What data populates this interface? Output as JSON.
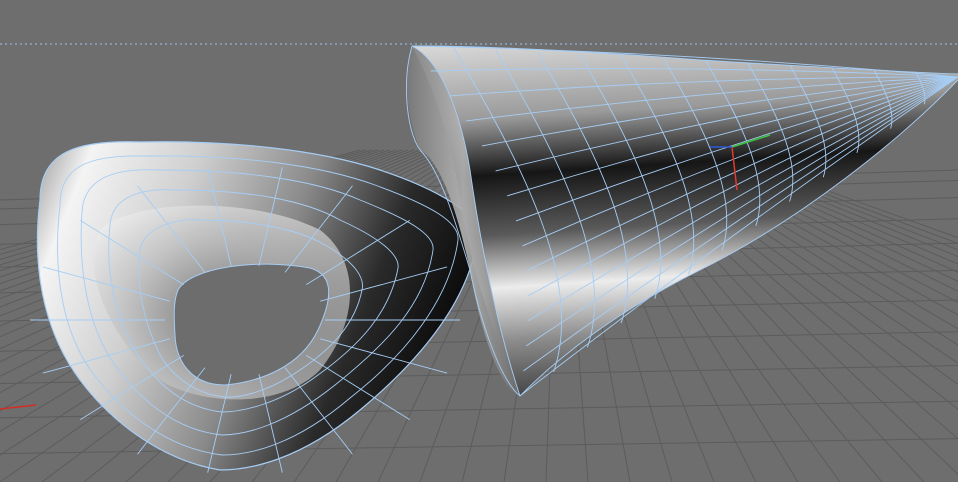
{
  "viewport": {
    "background_color": "#6e6e6e",
    "grid_color": "#5c5c5c",
    "horizon_color": "#9fc2e8",
    "wireframe_color": "#a6cdf4",
    "hole_color": "#6d6d6d"
  },
  "objects": [
    {
      "name": "torus-like-ring",
      "selected": true
    },
    {
      "name": "cone",
      "selected": true
    }
  ],
  "axis_gizmo": {
    "x_color": "#e03a2e",
    "y_color": "#39c63e",
    "z_color": "#2a5bd8"
  },
  "world_axis": {
    "x_color": "#d42e22"
  }
}
